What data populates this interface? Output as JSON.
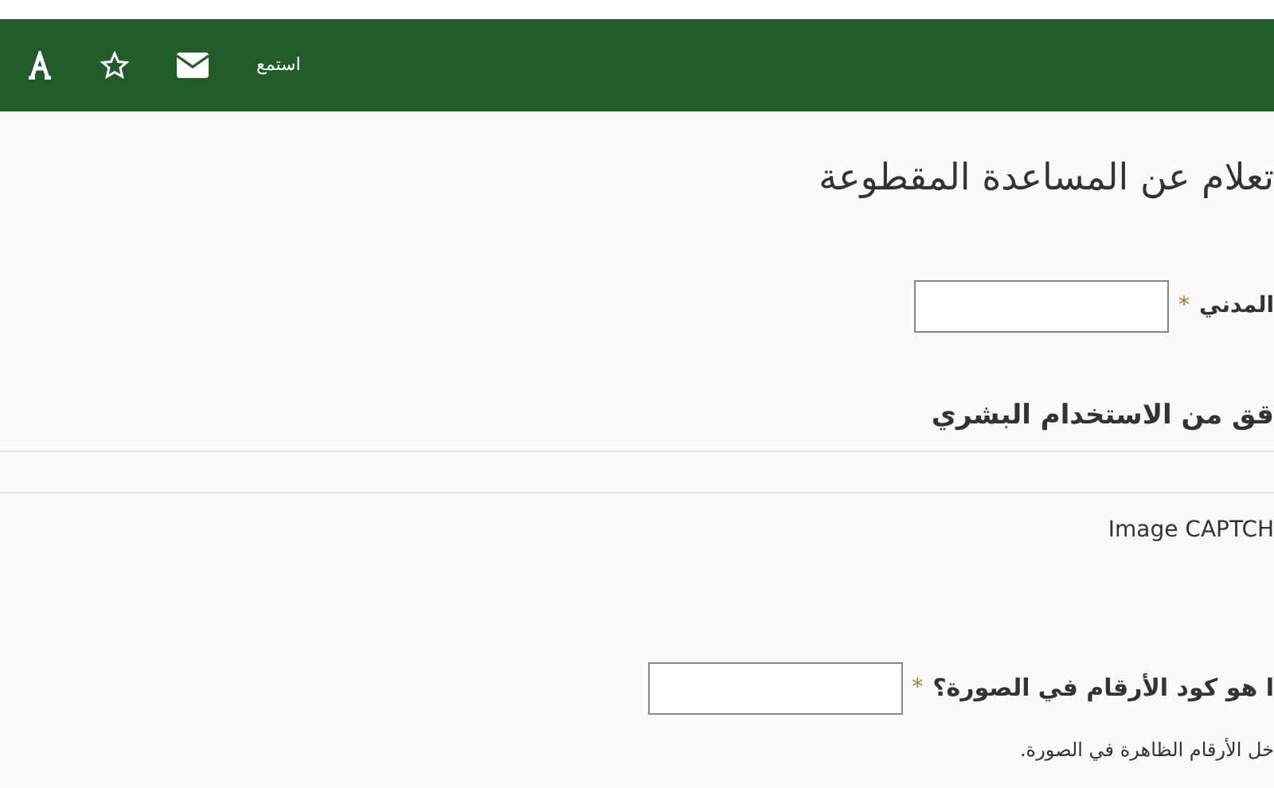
{
  "toolbar": {
    "items": [
      {
        "kind": "font"
      },
      {
        "kind": "star"
      },
      {
        "kind": "mail"
      },
      {
        "kind": "text",
        "label": "استمع"
      }
    ]
  },
  "title": "تعلام عن المساعدة المقطوعة",
  "civil_field": {
    "label": "المدني",
    "required_mark": "*"
  },
  "section_title": "قق من الاستخدام البشري",
  "captcha_label": "Image CAPTCH",
  "captcha_field": {
    "label": "ا هو كود الأرقام في الصورة؟",
    "required_mark": "*"
  },
  "help_text": "خل الأرقام الظاهرة في الصورة."
}
